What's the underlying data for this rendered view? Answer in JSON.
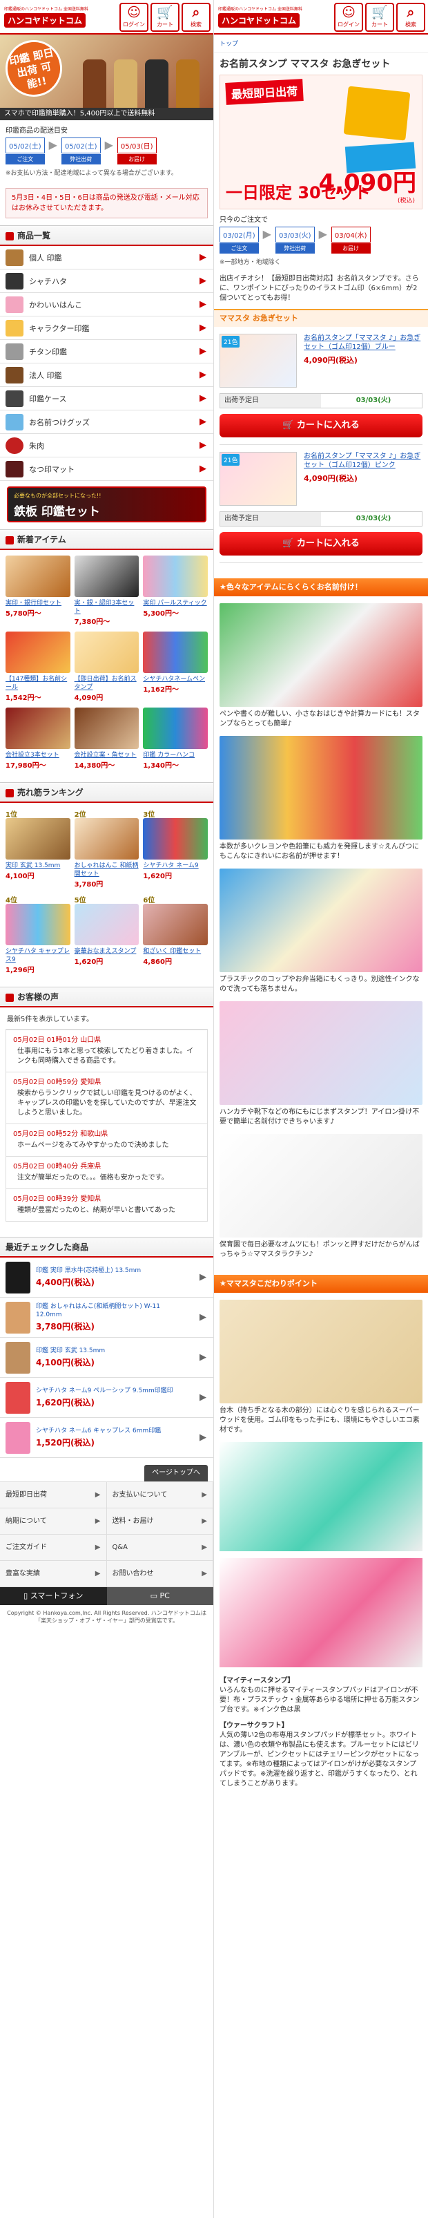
{
  "colors": {
    "brand": "#cc0000",
    "orange": "#f15a00",
    "link": "#1b58b8"
  },
  "header": {
    "tagline": "印鑑通販のハンコヤドットコム 全国送料無料",
    "brand": "ハンコヤドットコム",
    "buttons": [
      {
        "label": "ログイン",
        "icon": "person-icon"
      },
      {
        "label": "カート",
        "icon": "cart-icon"
      },
      {
        "label": "検索",
        "icon": "search-icon"
      }
    ]
  },
  "left": {
    "hero": {
      "badge": "印鑑 即日出荷 可能!!",
      "strip": "スマホで印鑑簡単購入！5,400円以上で送料無料"
    },
    "shipping": {
      "title": "印鑑商品の配送目安",
      "steps": [
        {
          "date": "05/02(土)",
          "label": "ご注文",
          "style": "blue"
        },
        {
          "date": "05/02(土)",
          "label": "弊社出荷",
          "style": "blue"
        },
        {
          "date": "05/03(日)",
          "label": "お届け",
          "style": "red"
        }
      ],
      "note": "※お支払い方法・配達地域によって異なる場合がございます。",
      "notice": "5月3日・4日・5日・6日は商品の発送及び電話・メール対応はお休みさせていただきます。"
    },
    "categories": {
      "title": "商品一覧",
      "items": [
        "個人 印鑑",
        "シャチハタ",
        "かわいいはんこ",
        "キャラクター印鑑",
        "チタン印鑑",
        "法人 印鑑",
        "印鑑ケース",
        "お名前つけグッズ",
        "朱肉",
        "なつ印マット"
      ]
    },
    "banner": {
      "sub": "必要なものが全部セットになった!!",
      "main": "鉄板 印鑑セット"
    },
    "new_items": {
      "title": "新着アイテム",
      "items": [
        {
          "name": "実印・銀行印セット",
          "price": "5,780円～"
        },
        {
          "name": "実・銀・認印3本セット",
          "price": "7,380円～"
        },
        {
          "name": "実印 パールスティック",
          "price": "5,300円～"
        },
        {
          "name": "【147種類】お名前シール",
          "price": "1,542円～"
        },
        {
          "name": "【即日出荷】お名前スタンプ",
          "price": "4,090円"
        },
        {
          "name": "シヤチハタネームペン",
          "price": "1,162円～"
        },
        {
          "name": "会社設立3本セット",
          "price": "17,980円～"
        },
        {
          "name": "会社設立案・角セット",
          "price": "14,380円～"
        },
        {
          "name": "印鑑 カラーハンコ",
          "price": "1,340円～"
        }
      ]
    },
    "ranking": {
      "title": "売れ筋ランキング",
      "items": [
        {
          "rank": "1位",
          "name": "実印 玄武 13.5mm",
          "price": "4,100円"
        },
        {
          "rank": "2位",
          "name": "おしゃれはんこ 和紙柄開セット",
          "price": "3,780円"
        },
        {
          "rank": "3位",
          "name": "シヤチハタ ネーム9",
          "price": "1,620円"
        },
        {
          "rank": "4位",
          "name": "シヤチハタ キャップレス9",
          "price": "1,296円"
        },
        {
          "rank": "5位",
          "name": "豪華おなまえスタンプ",
          "price": "1,620円"
        },
        {
          "rank": "6位",
          "name": "和ざいく 印鑑セット",
          "price": "4,860円"
        }
      ]
    },
    "voices": {
      "title": "お客様の声",
      "note": "最新5件を表示しています。",
      "items": [
        {
          "head": "05月02日 01時01分 山口県",
          "body": "仕事用にもう1本と思って検索してたどり着きました。インクも同時購入できる商品です。"
        },
        {
          "head": "05月02日 00時59分 愛知県",
          "body": "検索からランクリックで試しい印鑑を見つけるのがよく、キャップレスの印鑑いをを探していたのですが、早速注文しようと思いました。"
        },
        {
          "head": "05月02日 00時52分 和歌山県",
          "body": "ホームページをみてみやすかったので決めました"
        },
        {
          "head": "05月02日 00時40分 兵庫県",
          "body": "注文が簡単だったので。。。価格も安かったです。"
        },
        {
          "head": "05月02日 00時39分 愛知県",
          "body": "種類が豊富だったのと、納期が早いと書いてあった"
        }
      ]
    },
    "recent": {
      "title": "最近チェックした商品",
      "items": [
        {
          "name": "印鑑 実印 黒水牛(芯持極上) 13.5mm",
          "price": "4,400円(税込)"
        },
        {
          "name": "印鑑 おしゃれはんこ(和紙柄開セット) W-11 12.0mm",
          "price": "3,780円(税込)"
        },
        {
          "name": "印鑑 実印 玄武 13.5mm",
          "price": "4,100円(税込)"
        },
        {
          "name": "シヤチハタ ネーム9 ペルーシップ 9.5mm印鑑印",
          "price": "1,620円(税込)"
        },
        {
          "name": "シヤチハタ ネーム6 キャップレス 6mm印鑑",
          "price": "1,520円(税込)"
        }
      ]
    },
    "pagetop": "ページトップへ",
    "footer_nav": [
      "最短即日出荷",
      "お支払いについて",
      "納期について",
      "送料・お届け",
      "ご注文ガイド",
      "Q&A",
      "豊富な実績",
      "お問い合わせ"
    ],
    "switch": {
      "sp": "スマートフォン",
      "pc": "PC"
    },
    "copyright": "Copyright © Hankoya.com,Inc. All Rights Reserved. ハンコヤドットコムは「楽天ショップ・オブ・ザ・イヤー」部門の受賞店です。"
  },
  "right": {
    "breadcrumb": "トップ",
    "title": "お名前スタンプ ママスタ お急ぎセット",
    "hero": {
      "tag": "最短即日出荷",
      "tag2": "一日限定 30セット",
      "price": "4,090円",
      "tax": "(税込)"
    },
    "shipping": {
      "title": "只今のご注文で",
      "steps": [
        {
          "date": "03/02(月)",
          "label": "ご注文",
          "style": "blue"
        },
        {
          "date": "03/03(火)",
          "label": "弊社出荷",
          "style": "blue"
        },
        {
          "date": "03/04(水)",
          "label": "お届け",
          "style": "red"
        }
      ],
      "note": "※一部地方・地域除く"
    },
    "intro": "出店イチオシ！【最短即日出荷対応】お名前スタンプです。さらに、ワンポイントにぴったりのイラストゴム印（6×6mm）が2個ついてとってもお得！",
    "section": "ママスタ お急ぎセット",
    "items": [
      {
        "badge": "21色",
        "name": "お名前スタンプ「ママスタ ♪」お急ぎセット（ゴム印12個）ブルー",
        "price": "4,090円(税込)",
        "ship_label": "出荷予定日",
        "ship_date": "03/03(火)",
        "cart": "カートに入れる"
      },
      {
        "badge": "21色",
        "name": "お名前スタンプ「ママスタ ♪」お急ぎセット（ゴム印12個）ピンク",
        "price": "4,090円(税込)",
        "ship_label": "出荷予定日",
        "ship_date": "03/03(火)",
        "cart": "カートに入れる"
      }
    ],
    "feature_title": "★色々なアイテムにらくらくお名前付け！",
    "features": [
      "ペンや書くのが難しい、小さなおはじきや計算カードにも！スタンプならとっても簡単♪",
      "本数が多いクレヨンや色鉛筆にも威力を発揮します☆えんぴつにもこんなにきれいにお名前が押せます！",
      "プラスチックのコップやお弁当箱にもくっきり。別途性インクなので洗っても落ちません。",
      "ハンカチや靴下などの布にもにじまずスタンプ！アイロン掛け不要で簡単に名前付けできちゃいます♪",
      "保育園で毎日必要なオムツにも！ポンッと押すだけだからがんばっちゃう☆ママスタラクチン♪"
    ],
    "point_title": "★ママスタこだわりポイント",
    "point_caption": "台木（持ち手となる木の部分）には心ぐりを感じられるスーパーウッドを使用。ゴム印をもった手にも、環境にもやさしいエコ素材です。",
    "mighty": {
      "head": "【マイティースタンプ】",
      "body": "いろんなものに押せるマイティースタンプパッドはアイロンが不要！布・プラスチック・金属等あらゆる場所に押せる万能スタンプ台です。※インク色は黒",
      "head2": "【ウァーサクラフト】",
      "body2": "人気の薄い2色の布専用スタンプパッドが標準セット。ホワイトは、濃い色の衣類や布製品にも使えます。ブルーセットにはビリアンブルーが、ピンクセットにはチェリーピンクがセットになってます。※布地の種類によってはアイロンがけが必要なスタンプパッドです。※洗濯を繰り返すと、印鑑がうすくなったり、とれてしまうことがあります。"
    }
  }
}
